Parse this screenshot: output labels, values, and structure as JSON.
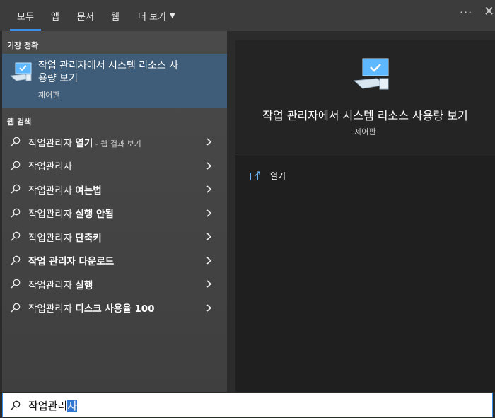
{
  "tabs": [
    {
      "label": "모두"
    },
    {
      "label": "앱"
    },
    {
      "label": "문서"
    },
    {
      "label": "웹"
    },
    {
      "label": "더 보기"
    }
  ],
  "header_more": "···",
  "header_close": "✕",
  "best_match": {
    "section": "기장 정확",
    "title": "작업 관리자에서 시스템 리소스 사용량 보기",
    "subtitle": "제어판"
  },
  "web_search": {
    "section": "웹 검색",
    "items": [
      {
        "prefix": "작업관리자 ",
        "bold": "열기",
        "hint": " - 웹 결과 보기"
      },
      {
        "prefix": "작업관리자",
        "bold": "",
        "hint": ""
      },
      {
        "prefix": "작업관리자 ",
        "bold": "여는법",
        "hint": ""
      },
      {
        "prefix": "작업관리자 ",
        "bold": "실행 안됨",
        "hint": ""
      },
      {
        "prefix": "작업관리자 ",
        "bold": "단축키",
        "hint": ""
      },
      {
        "prefix": "",
        "bold": "작업 관리자 다운로드",
        "hint": ""
      },
      {
        "prefix": "작업관리자 ",
        "bold": "실행",
        "hint": ""
      },
      {
        "prefix": "작업관리자 ",
        "bold": "디스크 사용율 100",
        "hint": ""
      }
    ]
  },
  "detail": {
    "title": "작업 관리자에서 시스템 리소스 사용량 보기",
    "subtitle": "제어판",
    "action": "열기"
  },
  "search": {
    "value_typed": "작업관리",
    "value_selected": "자"
  },
  "colors": {
    "accent": "#3a8ee6",
    "selected_bg": "#3f5d78"
  }
}
